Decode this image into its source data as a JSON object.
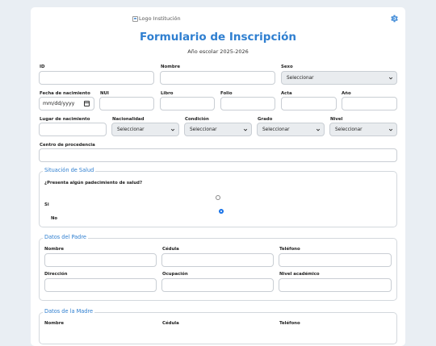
{
  "header": {
    "logo_alt": "Logo Institución",
    "settings_icon": "gear-icon",
    "title": "Formulario de Inscripción",
    "subtitle": "Año escolar 2025-2026"
  },
  "colors": {
    "accent": "#2f7fd0",
    "background": "#e9eef3",
    "radio_checked": "#1a73e8"
  },
  "student": {
    "id_label": "ID",
    "nombre_label": "Nombre",
    "sexo_label": "Sexo",
    "sexo_value": "Seleccionar",
    "fecha_label": "Fecha de nacimiento",
    "fecha_placeholder": "mm/dd/yyyy",
    "nui_label": "NUI",
    "libro_label": "Libro",
    "folio_label": "Folio",
    "acta_label": "Acta",
    "anio_label": "Año",
    "lugar_label": "Lugar de nacimiento",
    "nacionalidad_label": "Nacionalidad",
    "nacionalidad_value": "Seleccionar",
    "condicion_label": "Condición",
    "condicion_value": "Seleccionar",
    "grado_label": "Grado",
    "grado_value": "Seleccionar",
    "nivel_label": "Nivel",
    "nivel_value": "Seleccionar",
    "centro_label": "Centro de procedencia"
  },
  "salud": {
    "legend": "Situación de Salud",
    "question": "¿Presenta algún padecimiento de salud?",
    "option_si": "Si",
    "option_no": "No",
    "selected": "No"
  },
  "padre": {
    "legend": "Datos del Padre",
    "nombre_label": "Nombre",
    "cedula_label": "Cédula",
    "telefono_label": "Teléfono",
    "direccion_label": "Dirección",
    "ocupacion_label": "Ocupación",
    "nivel_label": "Nivel académico"
  },
  "madre": {
    "legend": "Datos de la Madre",
    "nombre_label": "Nombre",
    "cedula_label": "Cédula",
    "telefono_label": "Teléfono"
  }
}
